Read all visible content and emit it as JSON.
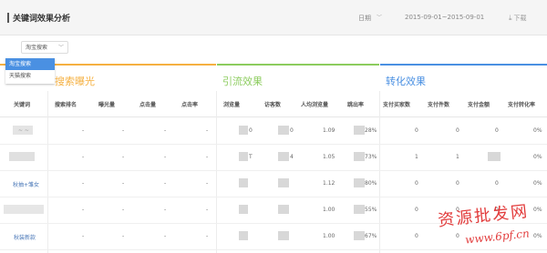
{
  "header": {
    "title": "关键词效果分析",
    "date_label": "日期",
    "date_range": "2015-09-01~2015-09-01",
    "download_label": "下载"
  },
  "filter": {
    "selected": "淘宝搜索",
    "options": [
      "淘宝搜索",
      "天猫搜索"
    ]
  },
  "groups": [
    {
      "title": "搜索曝光",
      "color": "#f5b041"
    },
    {
      "title": "引流效果",
      "color": "#8ccc5e"
    },
    {
      "title": "转化效果",
      "color": "#4a90e2"
    }
  ],
  "columns": [
    "关键词",
    "搜索排名",
    "曝光量",
    "点击量",
    "点击率",
    "浏览量",
    "访客数",
    "人均浏览量",
    "跳出率",
    "支付买家数",
    "支付件数",
    "支付金额",
    "支付转化率"
  ],
  "rows": [
    {
      "keyword": "~ ~",
      "rank": "-",
      "exposure": "-",
      "clicks": "-",
      "ctr": "-",
      "pv": "0",
      "uv": "0",
      "avg_pv": "1.09",
      "bounce": "28%",
      "buyers": "0",
      "items": "0",
      "amount": "0",
      "conv": "0%"
    },
    {
      "keyword": "",
      "rank": "-",
      "exposure": "-",
      "clicks": "-",
      "ctr": "-",
      "pv": "T",
      "uv": "4",
      "avg_pv": "1.05",
      "bounce": "73%",
      "buyers": "1",
      "items": "1",
      "amount": "",
      "conv": "0%"
    },
    {
      "keyword": "秋抽+雏女",
      "rank": "-",
      "exposure": "-",
      "clicks": "-",
      "ctr": "-",
      "pv": "",
      "uv": "",
      "avg_pv": "1.12",
      "bounce": "80%",
      "buyers": "0",
      "items": "0",
      "amount": "0",
      "conv": "0%"
    },
    {
      "keyword": "",
      "rank": "-",
      "exposure": "-",
      "clicks": "-",
      "ctr": "-",
      "pv": "",
      "uv": "",
      "avg_pv": "1.00",
      "bounce": "55%",
      "buyers": "0",
      "items": "0",
      "amount": "0",
      "conv": "0%"
    },
    {
      "keyword": "秋装新款",
      "rank": "-",
      "exposure": "-",
      "clicks": "-",
      "ctr": "-",
      "pv": "",
      "uv": "",
      "avg_pv": "1.00",
      "bounce": "67%",
      "buyers": "0",
      "items": "0",
      "amount": "0",
      "conv": "0%"
    }
  ],
  "watermark": {
    "text": "资源批发网",
    "url": "www.6pf.cn"
  },
  "colors": {
    "dropdown_active": "#4a90e2",
    "keyword_link": "#4a78b8"
  }
}
